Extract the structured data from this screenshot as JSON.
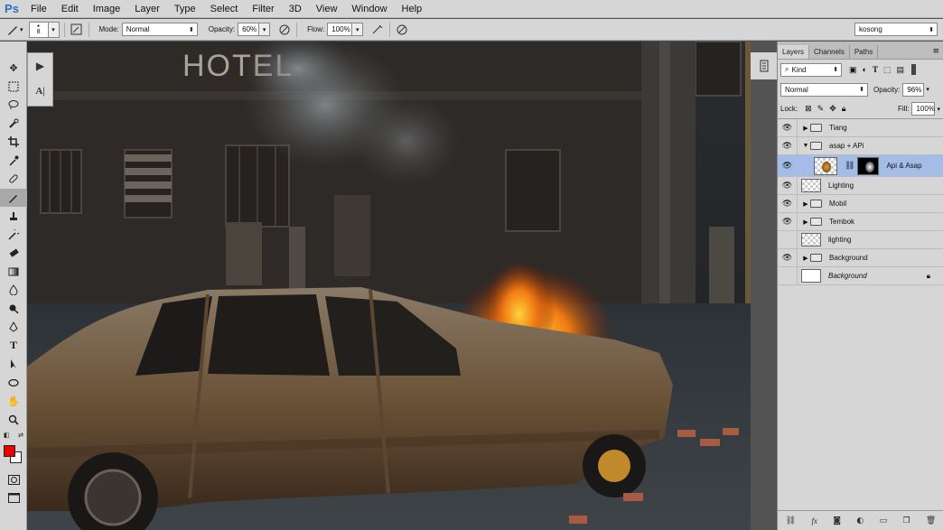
{
  "app": {
    "logo": "Ps"
  },
  "menu": [
    "File",
    "Edit",
    "Image",
    "Layer",
    "Type",
    "Select",
    "Filter",
    "3D",
    "View",
    "Window",
    "Help"
  ],
  "options": {
    "brush_size": "8",
    "mode_label": "Mode:",
    "mode_value": "Normal",
    "opacity_label": "Opacity:",
    "opacity_value": "60%",
    "flow_label": "Flow:",
    "flow_value": "100%",
    "workspace_value": "kosong"
  },
  "canvas": {
    "sign_text": "HOTEL"
  },
  "panel": {
    "tabs": [
      "Layers",
      "Channels",
      "Paths"
    ],
    "filter_kind": "Kind",
    "blend_mode": "Normal",
    "opacity_label": "Opacity:",
    "opacity_value": "96%",
    "lock_label": "Lock:",
    "fill_label": "Fill:",
    "fill_value": "100%"
  },
  "layers": [
    {
      "name": "Tiang",
      "type": "group",
      "visible": true,
      "expanded": false
    },
    {
      "name": "asap + APi",
      "type": "group",
      "visible": true,
      "expanded": true
    },
    {
      "name": "Api & Asap",
      "type": "layer-mask",
      "visible": true,
      "selected": true
    },
    {
      "name": "Lighting",
      "type": "layer",
      "visible": true
    },
    {
      "name": "Mobil",
      "type": "group",
      "visible": true,
      "expanded": false
    },
    {
      "name": "Tembok",
      "type": "group",
      "visible": true,
      "expanded": false
    },
    {
      "name": "lighting",
      "type": "layer",
      "visible": false
    },
    {
      "name": "Background",
      "type": "group",
      "visible": true,
      "expanded": false
    },
    {
      "name": "Background",
      "type": "background",
      "visible": false,
      "locked": true
    }
  ],
  "colors": {
    "foreground": "#e60000",
    "background": "#ffffff",
    "selection": "#a3bce8",
    "accent": "#2b70c9"
  }
}
